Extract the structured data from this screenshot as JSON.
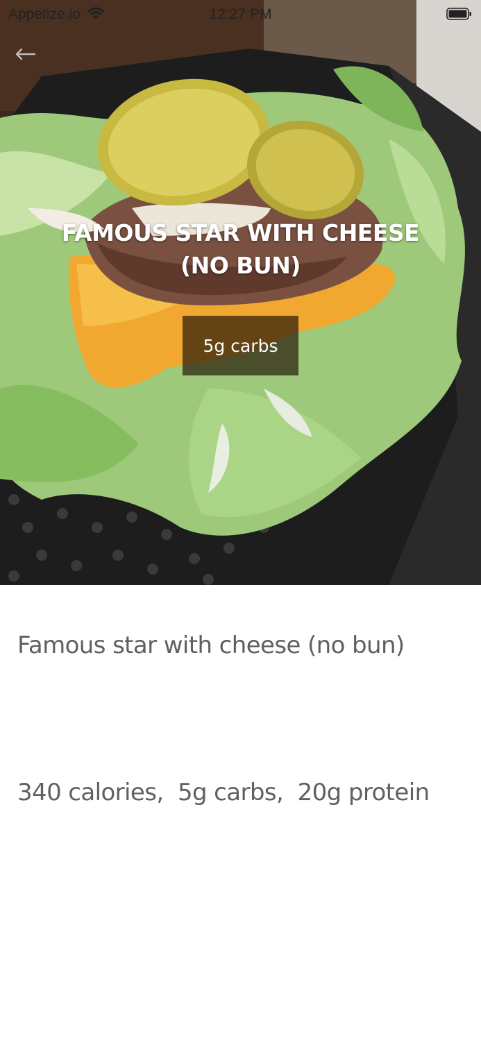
{
  "status_bar": {
    "carrier": "Appetize.io",
    "time": "12:27 PM",
    "wifi_icon": "wifi-icon",
    "battery_icon": "battery-icon"
  },
  "header": {
    "back_icon": "arrow-left-icon"
  },
  "hero": {
    "title": "FAMOUS STAR WITH CHEESE (NO BUN)",
    "badge": "5g carbs"
  },
  "details": {
    "name": "Famous star with cheese (no bun)",
    "nutrition": "340 calories,  5g carbs,  20g protein"
  },
  "colors": {
    "title_text": "#ffffff",
    "body_text": "#606060",
    "badge_bg": "#28190a"
  }
}
